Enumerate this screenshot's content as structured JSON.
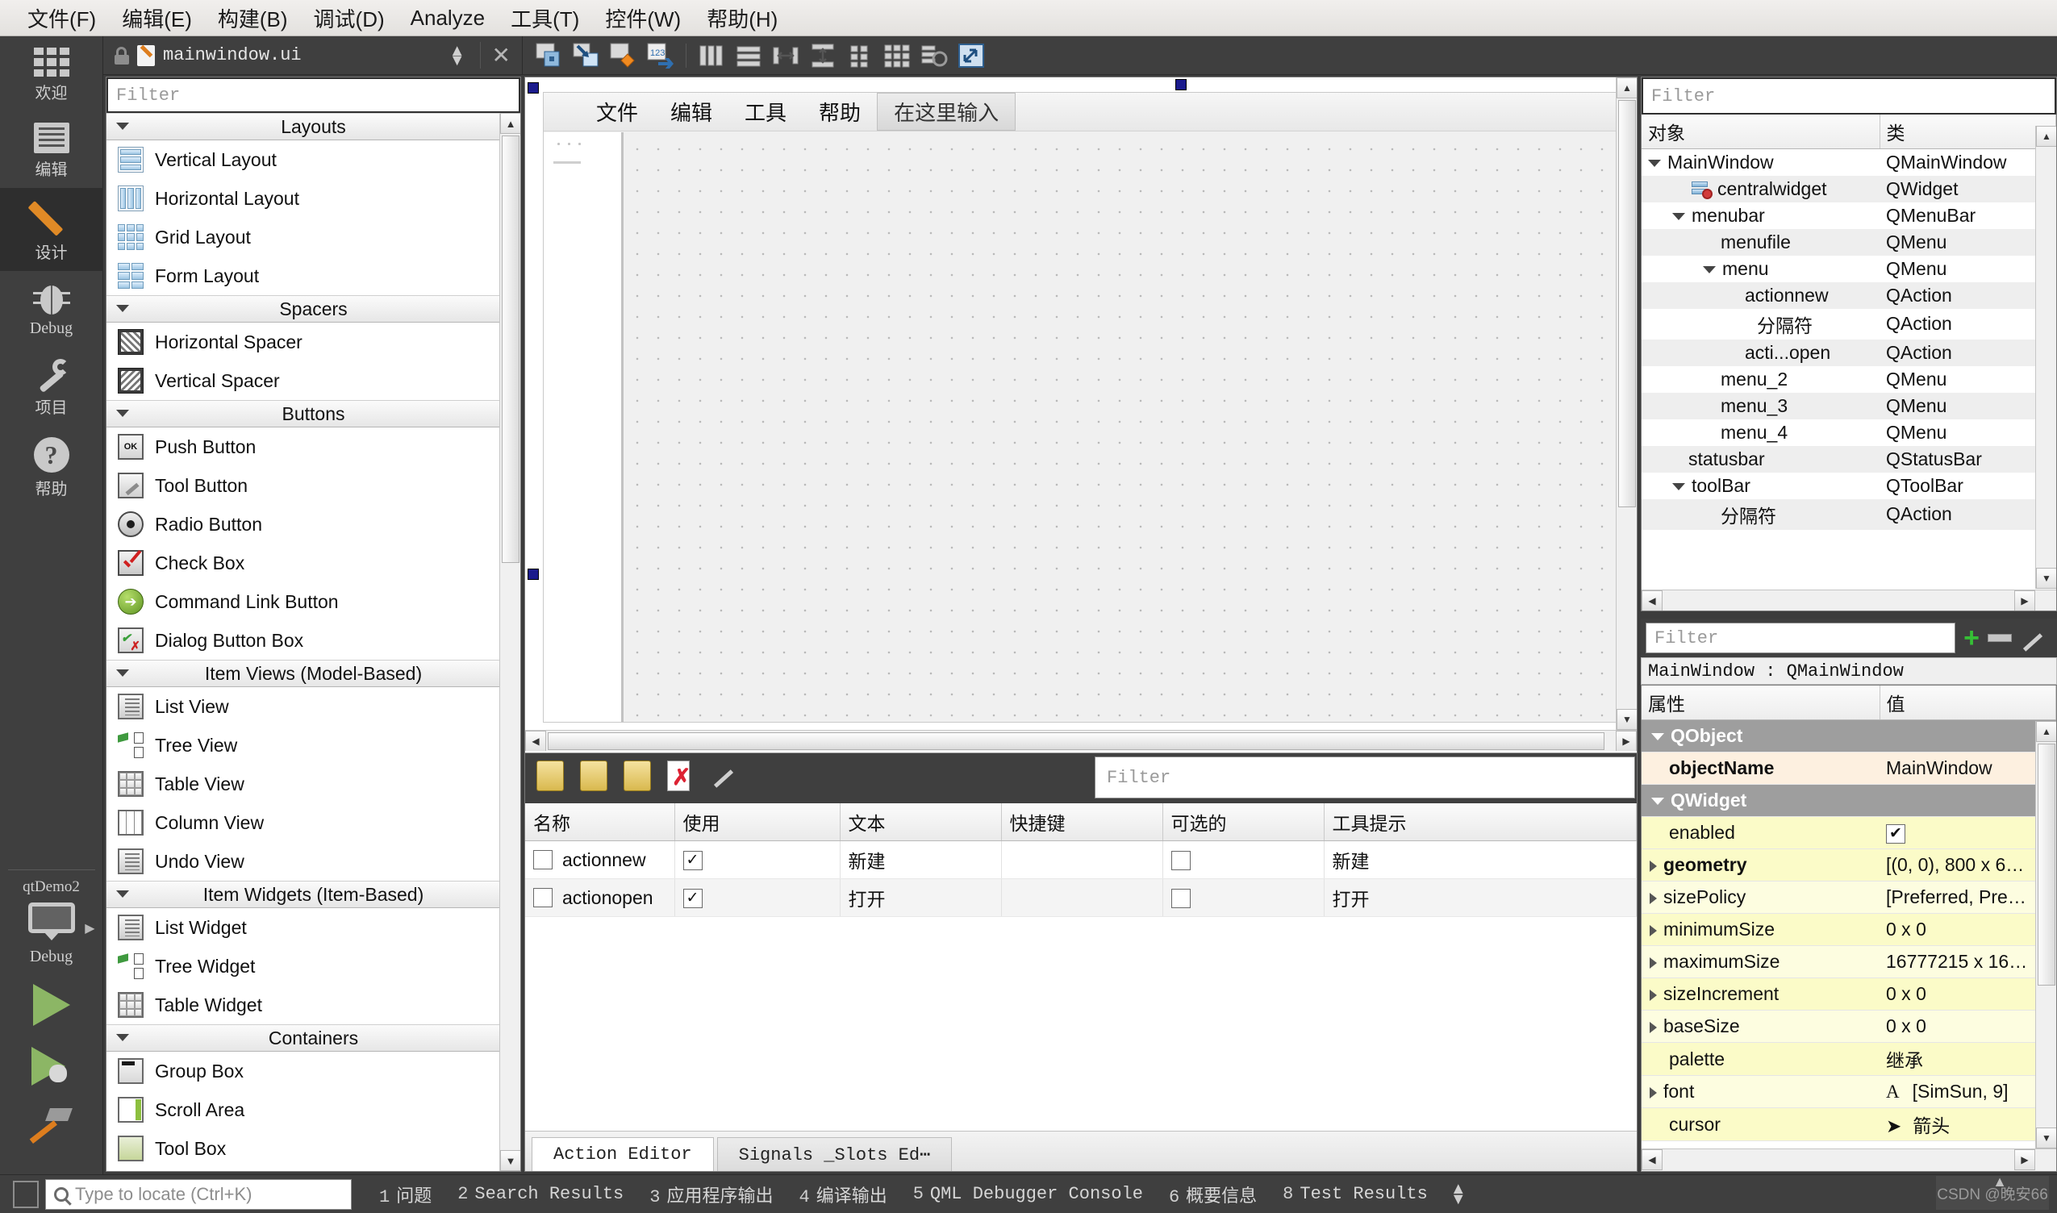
{
  "menubar": {
    "items": [
      {
        "label": "文件(F)",
        "mnemonic": "F"
      },
      {
        "label": "编辑(E)",
        "mnemonic": "E"
      },
      {
        "label": "构建(B)",
        "mnemonic": "B"
      },
      {
        "label": "调试(D)",
        "mnemonic": "D"
      },
      {
        "label": "Analyze",
        "mnemonic": "A"
      },
      {
        "label": "工具(T)",
        "mnemonic": "T"
      },
      {
        "label": "控件(W)",
        "mnemonic": "W"
      },
      {
        "label": "帮助(H)",
        "mnemonic": "H"
      }
    ]
  },
  "modebar": {
    "modes": [
      {
        "label": "欢迎",
        "icon": "grid-icon"
      },
      {
        "label": "编辑",
        "icon": "document-icon"
      },
      {
        "label": "设计",
        "icon": "pencil-icon"
      },
      {
        "label": "Debug",
        "icon": "bug-icon"
      },
      {
        "label": "项目",
        "icon": "wrench-icon"
      },
      {
        "label": "帮助",
        "icon": "question-icon"
      }
    ],
    "kit": {
      "project": "qtDemo2",
      "build": "Debug",
      "icon": "monitor-icon"
    },
    "run_buttons": [
      {
        "name": "run",
        "icon": "play-icon"
      },
      {
        "name": "debug",
        "icon": "play-bug-icon"
      },
      {
        "name": "build",
        "icon": "hammer-icon"
      }
    ]
  },
  "editor_bar": {
    "lock_icon": "unlock-icon",
    "file_icon": "ui-file-icon",
    "filename": "mainwindow.ui",
    "updown": "⬍",
    "close": "✕",
    "tools": [
      "edit-widgets-icon",
      "edit-signals-slots-icon",
      "edit-buddies-icon",
      "edit-tab-order-icon",
      "layout-horizontal-icon",
      "layout-vertical-icon",
      "layout-splitter-h-icon",
      "layout-splitter-v-icon",
      "layout-form-icon",
      "layout-grid-icon",
      "break-layout-icon",
      "adjust-size-icon"
    ]
  },
  "widget_box": {
    "filter_placeholder": "Filter",
    "groups": [
      {
        "title": "Layouts",
        "items": [
          {
            "label": "Vertical Layout",
            "icon": "vertical-layout-icon"
          },
          {
            "label": "Horizontal Layout",
            "icon": "horizontal-layout-icon"
          },
          {
            "label": "Grid Layout",
            "icon": "grid-layout-icon"
          },
          {
            "label": "Form Layout",
            "icon": "form-layout-icon"
          }
        ]
      },
      {
        "title": "Spacers",
        "items": [
          {
            "label": "Horizontal Spacer",
            "icon": "horizontal-spacer-icon"
          },
          {
            "label": "Vertical Spacer",
            "icon": "vertical-spacer-icon"
          }
        ]
      },
      {
        "title": "Buttons",
        "items": [
          {
            "label": "Push Button",
            "icon": "push-button-icon"
          },
          {
            "label": "Tool Button",
            "icon": "tool-button-icon"
          },
          {
            "label": "Radio Button",
            "icon": "radio-button-icon"
          },
          {
            "label": "Check Box",
            "icon": "check-box-icon"
          },
          {
            "label": "Command Link Button",
            "icon": "command-link-icon"
          },
          {
            "label": "Dialog Button Box",
            "icon": "dialog-button-box-icon"
          }
        ]
      },
      {
        "title": "Item Views (Model-Based)",
        "items": [
          {
            "label": "List View",
            "icon": "list-view-icon"
          },
          {
            "label": "Tree View",
            "icon": "tree-view-icon"
          },
          {
            "label": "Table View",
            "icon": "table-view-icon"
          },
          {
            "label": "Column View",
            "icon": "column-view-icon"
          },
          {
            "label": "Undo View",
            "icon": "undo-view-icon"
          }
        ]
      },
      {
        "title": "Item Widgets (Item-Based)",
        "items": [
          {
            "label": "List Widget",
            "icon": "list-widget-icon"
          },
          {
            "label": "Tree Widget",
            "icon": "tree-widget-icon"
          },
          {
            "label": "Table Widget",
            "icon": "table-widget-icon"
          }
        ]
      },
      {
        "title": "Containers",
        "items": [
          {
            "label": "Group Box",
            "icon": "group-box-icon"
          },
          {
            "label": "Scroll Area",
            "icon": "scroll-area-icon"
          },
          {
            "label": "Tool Box",
            "icon": "tool-box-icon"
          }
        ]
      }
    ]
  },
  "form_editor": {
    "menu_items": [
      "文件",
      "编辑",
      "工具",
      "帮助"
    ],
    "placeholder_menu": "在这里输入"
  },
  "action_editor": {
    "filter_placeholder": "Filter",
    "toolbar": [
      "new-action-icon",
      "copy-action-icon",
      "edit-action-icon",
      "delete-action-icon",
      "configure-icon"
    ],
    "columns": [
      "名称",
      "使用",
      "文本",
      "快捷键",
      "可选的",
      "工具提示"
    ],
    "rows": [
      {
        "name": "actionnew",
        "used": "✓",
        "text": "新建",
        "shortcut": "",
        "checkable": "",
        "tooltip": "新建"
      },
      {
        "name": "actionopen",
        "used": "✓",
        "text": "打开",
        "shortcut": "",
        "checkable": "",
        "tooltip": "打开"
      }
    ],
    "tabs": [
      {
        "label": "Action Editor",
        "active": true
      },
      {
        "label": "Signals _Slots Ed⋯",
        "active": false
      }
    ]
  },
  "object_inspector": {
    "filter_placeholder": "Filter",
    "columns": [
      "对象",
      "类"
    ],
    "rows": [
      {
        "object": "MainWindow",
        "class": "QMainWindow",
        "indent": 0,
        "expander": "down",
        "icon": ""
      },
      {
        "object": "centralwidget",
        "class": "QWidget",
        "indent": 2,
        "expander": "",
        "icon": "central-widget-icon"
      },
      {
        "object": "menubar",
        "class": "QMenuBar",
        "indent": 1,
        "expander": "down",
        "icon": ""
      },
      {
        "object": "menufile",
        "class": "QMenu",
        "indent": 2,
        "expander": "",
        "icon": ""
      },
      {
        "object": "menu",
        "class": "QMenu",
        "indent": 2,
        "expander": "down",
        "icon": ""
      },
      {
        "object": "actionnew",
        "class": "QAction",
        "indent": 3,
        "expander": "",
        "icon": ""
      },
      {
        "object": "分隔符",
        "class": "QAction",
        "indent": 3,
        "expander": "",
        "icon": ""
      },
      {
        "object": "acti...open",
        "class": "QAction",
        "indent": 3,
        "expander": "",
        "icon": ""
      },
      {
        "object": "menu_2",
        "class": "QMenu",
        "indent": 2,
        "expander": "",
        "icon": ""
      },
      {
        "object": "menu_3",
        "class": "QMenu",
        "indent": 2,
        "expander": "",
        "icon": ""
      },
      {
        "object": "menu_4",
        "class": "QMenu",
        "indent": 2,
        "expander": "",
        "icon": ""
      },
      {
        "object": "statusbar",
        "class": "QStatusBar",
        "indent": 1,
        "expander": "",
        "icon": ""
      },
      {
        "object": "toolBar",
        "class": "QToolBar",
        "indent": 1,
        "expander": "down",
        "icon": ""
      },
      {
        "object": "分隔符",
        "class": "QAction",
        "indent": 2,
        "expander": "",
        "icon": ""
      }
    ]
  },
  "property_editor": {
    "filter_placeholder": "Filter",
    "add_label": "+",
    "remove_label": "−",
    "configure_icon": "wrench-icon",
    "selection": "MainWindow : QMainWindow",
    "columns": [
      "属性",
      "值"
    ],
    "rows": [
      {
        "kind": "group",
        "name": "QObject",
        "value": ""
      },
      {
        "kind": "bold",
        "name": "objectName",
        "value": "MainWindow",
        "style": "rowA"
      },
      {
        "kind": "group",
        "name": "QWidget",
        "value": ""
      },
      {
        "kind": "check",
        "name": "enabled",
        "value": "✔",
        "style": "rowY"
      },
      {
        "kind": "boldx",
        "name": "geometry",
        "value": "[(0, 0), 800 x 6…",
        "style": "rowY"
      },
      {
        "kind": "expand",
        "name": "sizePolicy",
        "value": "[Preferred, Pre…",
        "style": "rowY2"
      },
      {
        "kind": "expand",
        "name": "minimumSize",
        "value": "0 x 0",
        "style": "rowY"
      },
      {
        "kind": "expand",
        "name": "maximumSize",
        "value": "16777215 x 16…",
        "style": "rowY2"
      },
      {
        "kind": "expand",
        "name": "sizeIncrement",
        "value": "0 x 0",
        "style": "rowY"
      },
      {
        "kind": "expand",
        "name": "baseSize",
        "value": "0 x 0",
        "style": "rowY2"
      },
      {
        "kind": "plain",
        "name": "palette",
        "value": "继承",
        "style": "rowY"
      },
      {
        "kind": "font",
        "name": "font",
        "value": "[SimSun, 9]",
        "style": "rowY2"
      },
      {
        "kind": "cursor",
        "name": "cursor",
        "value": "箭头",
        "style": "rowY"
      }
    ]
  },
  "statusbar": {
    "locate_placeholder": "Type to locate (Ctrl+K)",
    "panes": [
      {
        "num": "1",
        "label": "问题"
      },
      {
        "num": "2",
        "label": "Search Results"
      },
      {
        "num": "3",
        "label": "应用程序输出"
      },
      {
        "num": "4",
        "label": "编译输出"
      },
      {
        "num": "5",
        "label": "QML Debugger Console"
      },
      {
        "num": "6",
        "label": "概要信息"
      },
      {
        "num": "8",
        "label": "Test Results"
      }
    ],
    "watermark": "CSDN @晚安66"
  }
}
